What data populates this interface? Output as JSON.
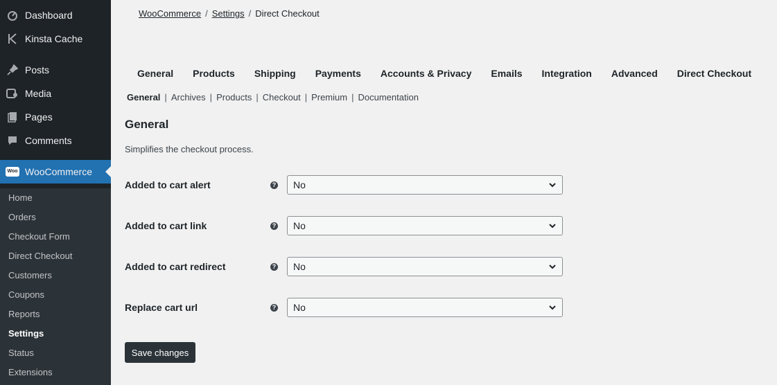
{
  "sidebar": {
    "items": [
      {
        "label": "Dashboard",
        "icon": "dashboard-icon"
      },
      {
        "label": "Kinsta Cache",
        "icon": "kinsta-icon"
      },
      {
        "label": "Posts",
        "icon": "pin-icon"
      },
      {
        "label": "Media",
        "icon": "media-icon"
      },
      {
        "label": "Pages",
        "icon": "pages-icon"
      },
      {
        "label": "Comments",
        "icon": "comments-icon"
      },
      {
        "label": "WooCommerce",
        "icon": "woocommerce-icon",
        "badge": "Woo"
      }
    ],
    "submenu": [
      {
        "label": "Home"
      },
      {
        "label": "Orders"
      },
      {
        "label": "Checkout Form"
      },
      {
        "label": "Direct Checkout"
      },
      {
        "label": "Customers"
      },
      {
        "label": "Coupons"
      },
      {
        "label": "Reports"
      },
      {
        "label": "Settings"
      },
      {
        "label": "Status"
      },
      {
        "label": "Extensions"
      }
    ]
  },
  "breadcrumb": {
    "items": [
      "WooCommerce",
      "Settings",
      "Direct Checkout"
    ],
    "separator": "/"
  },
  "tabs": [
    "General",
    "Products",
    "Shipping",
    "Payments",
    "Accounts & Privacy",
    "Emails",
    "Integration",
    "Advanced",
    "Direct Checkout"
  ],
  "subtabs": [
    "General",
    "Archives",
    "Products",
    "Checkout",
    "Premium",
    "Documentation"
  ],
  "section": {
    "title": "General",
    "description": "Simplifies the checkout process."
  },
  "fields": [
    {
      "label": "Added to cart alert",
      "value": "No"
    },
    {
      "label": "Added to cart link",
      "value": "No"
    },
    {
      "label": "Added to cart redirect",
      "value": "No"
    },
    {
      "label": "Replace cart url",
      "value": "No"
    }
  ],
  "help_glyph": "?",
  "save_label": "Save changes",
  "colors": {
    "sidebar": "#1d2327",
    "submenu": "#2c3338",
    "active": "#2271b1",
    "background": "#f1f1f1"
  }
}
